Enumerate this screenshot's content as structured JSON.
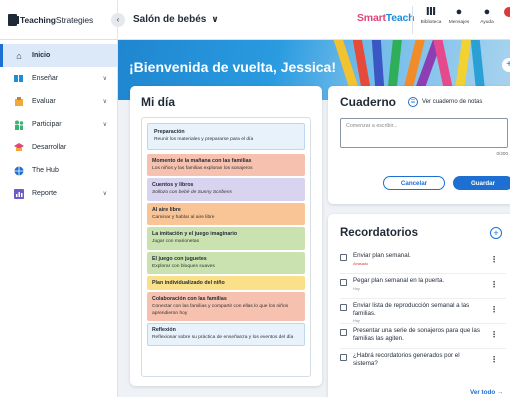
{
  "header": {
    "logo_bold": "Teaching",
    "logo_rest": "Strategies",
    "room": "Salón de bebés",
    "brand_a": "Smart",
    "brand_b": "Teach",
    "icons": [
      {
        "label": "Biblioteca",
        "icon": "library-icon"
      },
      {
        "label": "Mensajes",
        "icon": "messages-icon"
      },
      {
        "label": "Ayuda",
        "icon": "help-icon"
      }
    ]
  },
  "sidebar": {
    "items": [
      {
        "label": "Inicio",
        "icon": "home-icon",
        "active": true
      },
      {
        "label": "Enseñar",
        "icon": "teach-icon",
        "chevron": true
      },
      {
        "label": "Evaluar",
        "icon": "assess-icon",
        "chevron": true
      },
      {
        "label": "Participar",
        "icon": "family-icon",
        "chevron": true
      },
      {
        "label": "Desarrollar",
        "icon": "develop-icon"
      },
      {
        "label": "The Hub",
        "icon": "globe-icon"
      },
      {
        "label": "Reporte",
        "icon": "report-icon",
        "chevron": true
      }
    ]
  },
  "hero": {
    "title": "¡Bienvenida de vuelta, Jessica!"
  },
  "midia": {
    "title": "Mi día",
    "slots": [
      {
        "title": "Preparación",
        "desc": "Reunir los materiales y prepararse para el día",
        "color": "#e7f2fb",
        "border": "#bcd7ee"
      },
      {
        "title": "Momento de la mañana con las familias",
        "desc": "Los niños y las familias exploran los sonajeros",
        "color": "#f6c1ae",
        "border": "#f6c1ae"
      },
      {
        "title": "Cuentos y libros",
        "desc": "Sollozo con bebé de Sunny Scribens",
        "color": "#d8d3ee",
        "border": "#d8d3ee",
        "italic": true
      },
      {
        "title": "Al aire libre",
        "desc": "Caminar y hablar al aire libre",
        "color": "#f9c596",
        "border": "#f9c596"
      },
      {
        "title": "La imitación y el juego imaginario",
        "desc": "Jugar con marionetas",
        "color": "#c9e2b0",
        "border": "#c9e2b0"
      },
      {
        "title": "El juego con juguetes",
        "desc": "Explorar con bloques suaves",
        "color": "#c9e2b0",
        "border": "#c9e2b0"
      },
      {
        "title": "Plan individualizado del niño",
        "desc": "",
        "color": "#fbe08a",
        "border": "#fbe08a"
      },
      {
        "title": "Colaboración con las familias",
        "desc": "Conectar con las familias y compartir con ellas lo que los niños aprendieron hoy",
        "color": "#f6c1ae",
        "border": "#f6c1ae"
      },
      {
        "title": "Reflexión",
        "desc": "Reflexionar sobre su práctica de enseñanza y los eventos del día",
        "color": "#e7f2fb",
        "border": "#bcd7ee"
      }
    ]
  },
  "cuaderno": {
    "title": "Cuaderno",
    "link": "Ver cuaderno de notas",
    "placeholder": "Comenzar a escribir...",
    "count": "0/200",
    "cancel": "Cancelar",
    "save": "Guardar"
  },
  "recordatorios": {
    "title": "Recordatorios",
    "items": [
      {
        "text": "Enviar plan semanal.",
        "sub": "Atrasado",
        "due": true
      },
      {
        "text": "Pegar plan semanal en la puerta.",
        "sub": "Hoy"
      },
      {
        "text": "Enviar lista de reproducción semanal a las familias.",
        "sub": "Hoy"
      },
      {
        "text": "Presentar una serie de sonajeros para que las familias las agiten.",
        "sub": ""
      },
      {
        "text": "¿Habrá recordatorios generados por el sistema?",
        "sub": ""
      }
    ],
    "see_all": "Ver todo →"
  }
}
